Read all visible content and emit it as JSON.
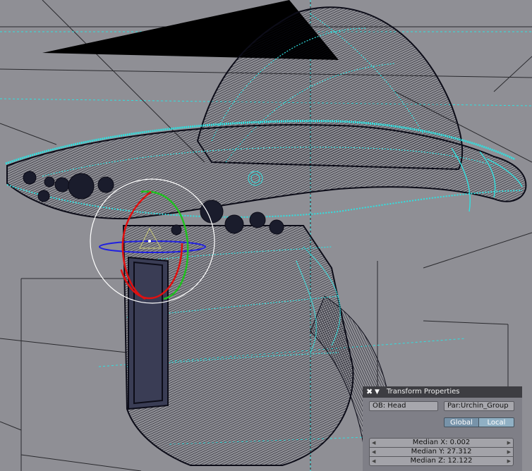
{
  "viewport": {
    "background": "#8f8f95",
    "wire_color": "#0c0c18",
    "selected_wire_color": "#30e0e0",
    "object_dark_color": "#2a2d44"
  },
  "manipulator": {
    "x_axis_color": "#e01010",
    "y_axis_color": "#20c020",
    "z_axis_color": "#2020e0",
    "outer_ring_color": "#ffffff"
  },
  "transform_panel": {
    "title": "Transform Properties",
    "close_icon": "close-icon",
    "collapse_icon": "triangle-down-icon",
    "object_field": "OB: Head",
    "parent_field": "Par:Urchin_Group",
    "global_label": "Global",
    "local_label": "Local",
    "active_mode": "Global",
    "median_x": "Median X: 0.002",
    "median_y": "Median Y: 27.312",
    "median_z": "Median Z: 12.122"
  }
}
